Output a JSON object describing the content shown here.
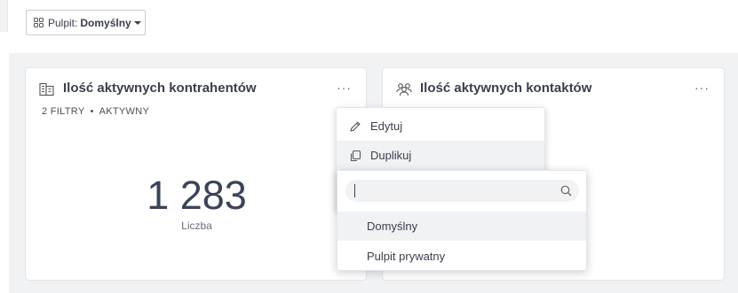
{
  "dashboard_selector": {
    "label": "Pulpit:",
    "value": "Domyślny",
    "icon": "grid-icon"
  },
  "cards": [
    {
      "title": "Ilość aktywnych kontrahentów",
      "icon": "building-icon",
      "menu_label": "···",
      "filters_label": "2 FILTRY",
      "separator": "•",
      "status_label": "AKTYWNY",
      "metric_value": "1 283",
      "metric_label": "Liczba"
    },
    {
      "title": "Ilość aktywnych kontaktów",
      "icon": "people-icon",
      "menu_label": "···"
    }
  ],
  "context_menu": {
    "items": [
      {
        "label": "Edytuj",
        "icon": "pencil-icon"
      },
      {
        "label": "Duplikuj",
        "icon": "copy-icon"
      }
    ]
  },
  "duplicate_submenu": {
    "search_placeholder": "",
    "search_icon": "search-icon",
    "options": [
      {
        "label": "Domyślny"
      },
      {
        "label": "Pulpit prywatny"
      }
    ]
  },
  "colors": {
    "canvas_bg": "#f1f2f4",
    "card_bg": "#ffffff",
    "text": "#3a3f4b",
    "metric": "#3a4457"
  }
}
